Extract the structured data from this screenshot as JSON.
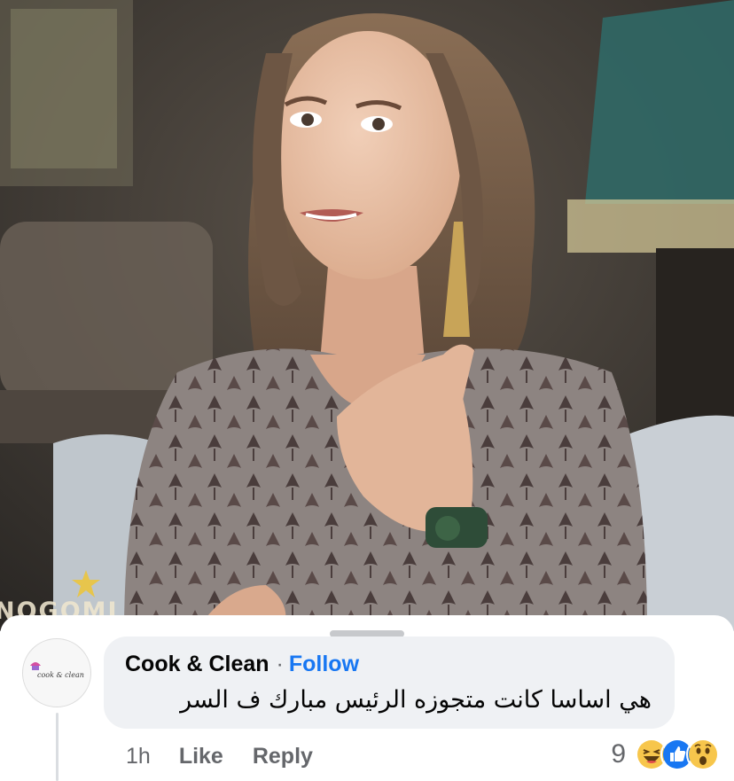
{
  "photo": {
    "description_icon": "video-still-icon",
    "watermark": "NOGOMI"
  },
  "comment": {
    "author": "Cook & Clean",
    "separator": "·",
    "follow_label": "Follow",
    "avatar_text": "cook & clean",
    "text": "هي اساسا كانت متجوزه الرئيس مبارك ف السر",
    "time": "1h",
    "like_label": "Like",
    "reply_label": "Reply",
    "reaction_count": "9",
    "reactions": [
      "haha-icon",
      "like-icon",
      "wow-icon"
    ]
  },
  "colors": {
    "bubble": "#eff1f4",
    "follow_blue": "#1877f2",
    "muted": "#65676b",
    "like_blue": "#1877f2",
    "emoji_yellow": "#f7c64c"
  }
}
